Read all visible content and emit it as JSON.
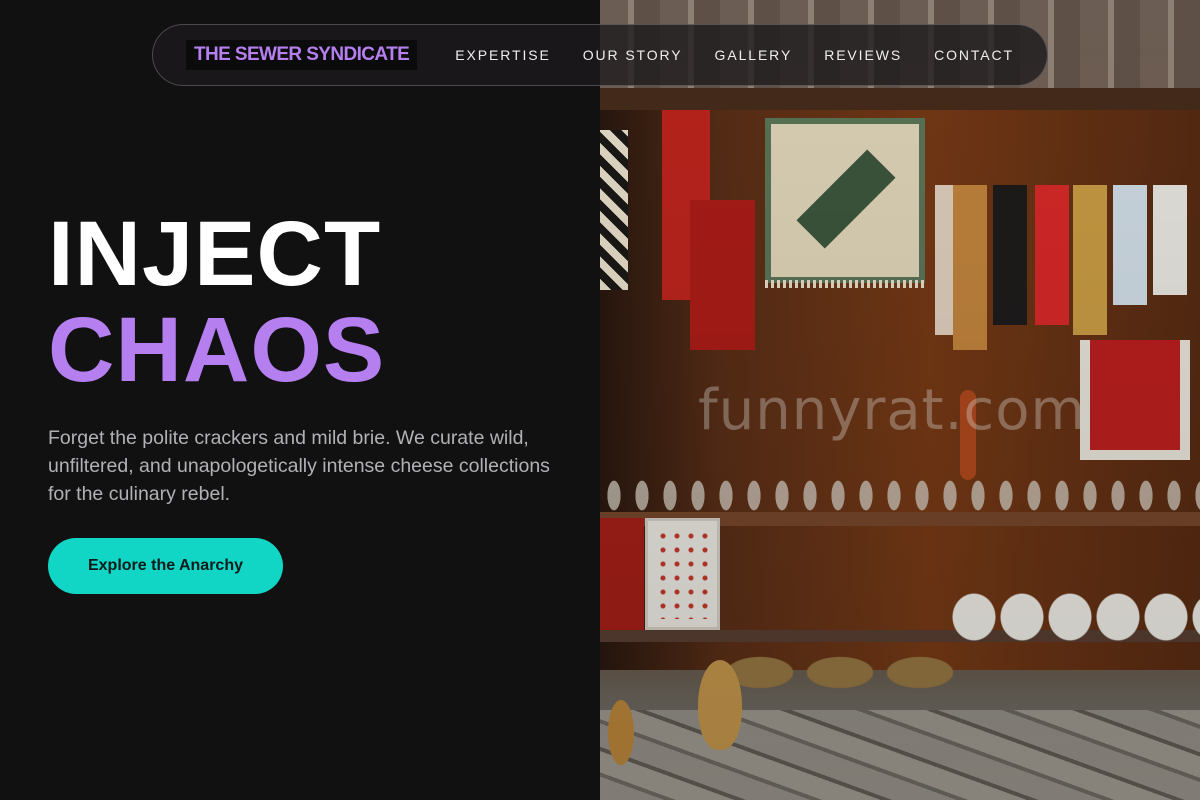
{
  "brand": {
    "name": "THE SEWER SYNDICATE",
    "color": "#b57ff0"
  },
  "nav": {
    "links": [
      "EXPERTISE",
      "OUR STORY",
      "GALLERY",
      "REVIEWS",
      "CONTACT"
    ]
  },
  "hero": {
    "title_line1": "INJECT",
    "title_line2": "CHAOS",
    "description": "Forget the polite crackers and mild brie. We curate wild, unfiltered, and unapologetically intense cheese collections for the culinary rebel.",
    "cta_label": "Explore the Anarchy",
    "accent_color": "#11d6c6"
  },
  "photo": {
    "watermark": "funnyrat.com"
  }
}
